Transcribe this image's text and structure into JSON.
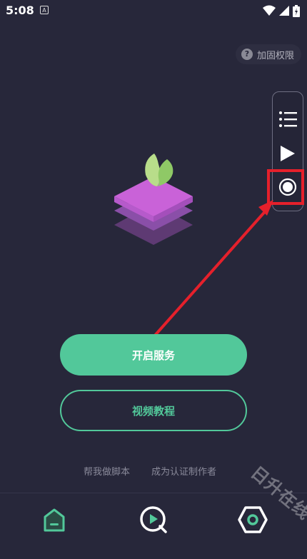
{
  "status_bar": {
    "time": "5:08",
    "notif_badge": "A"
  },
  "permission_chip": {
    "icon": "help-circle-icon",
    "label": "加固权限"
  },
  "floating_panel": {
    "items": [
      {
        "name": "list-icon"
      },
      {
        "name": "play-icon"
      },
      {
        "name": "record-icon",
        "highlighted": true
      }
    ],
    "highlight_color": "#e5202b"
  },
  "buttons": {
    "start_service": "开启服务",
    "video_tutorial": "视频教程"
  },
  "links": {
    "help_write_script": "帮我做脚本",
    "become_author": "成为认证制作者"
  },
  "bottom_nav": [
    {
      "icon": "home-icon"
    },
    {
      "icon": "video-icon"
    },
    {
      "icon": "settings-icon"
    }
  ],
  "watermark": "日升在线",
  "colors": {
    "background": "#27273a",
    "accent": "#52c89a",
    "annotation_red": "#e5202b"
  }
}
